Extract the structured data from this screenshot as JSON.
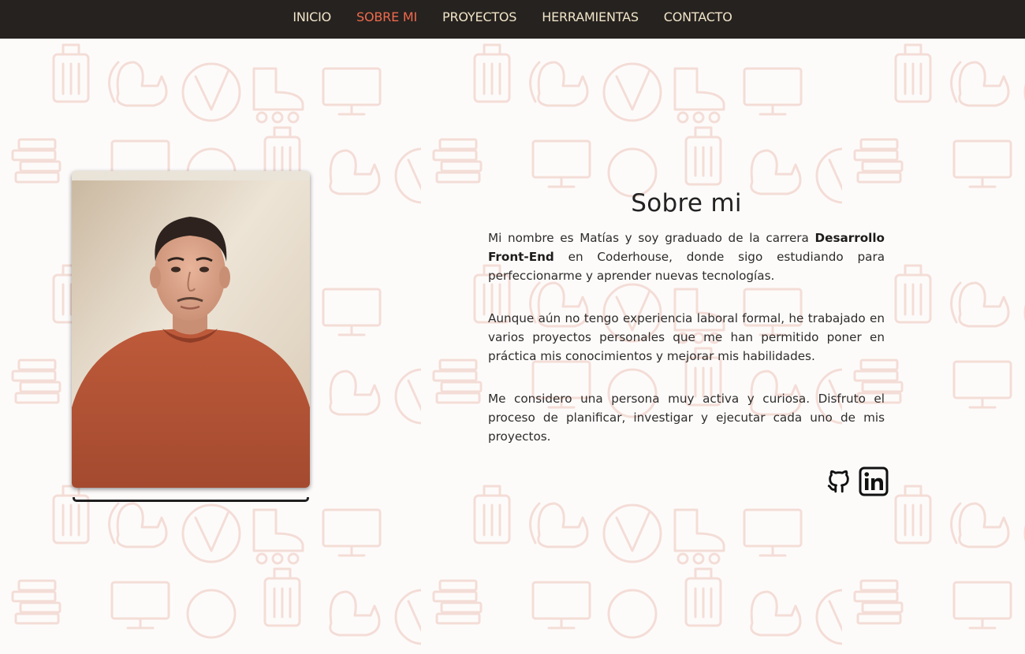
{
  "nav": {
    "items": [
      {
        "label": "INICIO",
        "active": false
      },
      {
        "label": "SOBRE MI",
        "active": true
      },
      {
        "label": "PROYECTOS",
        "active": false
      },
      {
        "label": "HERRAMIENTAS",
        "active": false
      },
      {
        "label": "CONTACTO",
        "active": false
      }
    ]
  },
  "about": {
    "title": "Sobre mi",
    "p1_part1": "Mi nombre es Matías y soy graduado de la carrera ",
    "p1_bold": "Desarrollo Front-End",
    "p1_part2": " en Coderhouse, donde sigo estudiando para perfeccionarme y aprender nuevas tecnologías.",
    "p2": "Aunque aún no tengo experiencia laboral formal, he trabajado en varios proyectos personales que me han permitido poner en práctica mis conocimientos y mejorar mis habilidades.",
    "p3": "Me considero una persona muy activa y curiosa. Disfruto el proceso de planificar, investigar y ejecutar cada uno de mis proyectos."
  },
  "social": {
    "icons": [
      "github-icon",
      "linkedin-icon"
    ]
  },
  "colors": {
    "navbar_bg": "#26221f",
    "nav_text": "#f1e4c9",
    "nav_active": "#ee6a4d",
    "pattern": "#f3d9d3"
  }
}
